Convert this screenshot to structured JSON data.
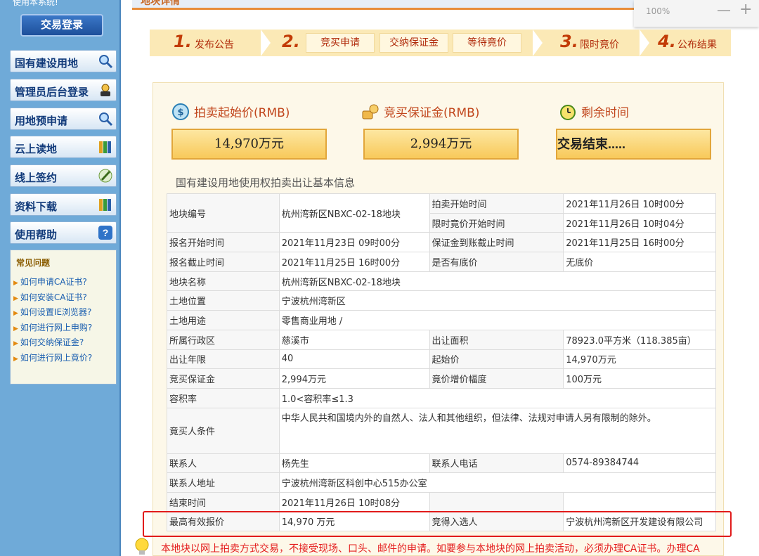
{
  "sidebar": {
    "top_text": "使用本系统!",
    "login_button": "交易登录",
    "nav": [
      {
        "label": "国有建设用地",
        "icon": "magnifier-icon"
      },
      {
        "label": "管理员后台登录",
        "icon": "admin-icon"
      },
      {
        "label": "用地预申请",
        "icon": "magnifier-icon"
      },
      {
        "label": "云上读地",
        "icon": "books-icon"
      },
      {
        "label": "线上签约",
        "icon": "pen-icon"
      },
      {
        "label": "资料下载",
        "icon": "books-icon"
      },
      {
        "label": "使用帮助",
        "icon": "question-icon"
      }
    ],
    "faq": {
      "title": "常见问题",
      "items": [
        "如何申请CA证书?",
        "如何安装CA证书?",
        "如何设置IE浏览器?",
        "如何进行网上申购?",
        "如何交纳保证金?",
        "如何进行网上竟价?"
      ]
    }
  },
  "top": {
    "tab_title": "地块详情",
    "zoom": "100%",
    "zoom_minus": "—",
    "zoom_plus": "+"
  },
  "steps": {
    "s1_num": "1.",
    "s1_text": "发布公告",
    "s2_num": "2.",
    "s2_sub": [
      "竞买申请",
      "交纳保证金",
      "等待竟价"
    ],
    "s3_num": "3.",
    "s3_text": "限时竟价",
    "s4_num": "4.",
    "s4_text": "公布结果"
  },
  "summary": {
    "start_price_label": "拍卖起始价(RMB)",
    "start_price_value": "14,970万元",
    "deposit_label": "竞买保证金(RMB)",
    "deposit_value": "2,994万元",
    "remaining_label": "剩余时间",
    "remaining_value": "交易结束....."
  },
  "section_title": "国有建设用地使用权拍卖出让基本信息",
  "table": {
    "plot_no_label": "地块编号",
    "plot_no": "杭州湾新区NBXC-02-18地块",
    "auction_start_label": "拍卖开始时间",
    "auction_start": "2021年11月26日 10时00分",
    "timed_bid_start_label": "限时竟价开始时间",
    "timed_bid_start": "2021年11月26日 10时04分",
    "reg_start_label": "报名开始时间",
    "reg_start": "2021年11月23日 09时00分",
    "deposit_deadline_label": "保证金到账截止时间",
    "deposit_deadline": "2021年11月25日 16时00分",
    "reg_end_label": "报名截止时间",
    "reg_end": "2021年11月25日 16时00分",
    "reserve_label": "是否有底价",
    "reserve": "无底价",
    "plot_name_label": "地块名称",
    "plot_name": "杭州湾新区NBXC-02-18地块",
    "location_label": "土地位置",
    "location": "宁波杭州湾新区",
    "use_label": "土地用途",
    "use": "零售商业用地 /",
    "district_label": "所属行政区",
    "district": "慈溪市",
    "area_label": "出让面积",
    "area": "78923.0平方米（118.385亩）",
    "term_label": "出让年限",
    "term": "40",
    "start_price_label": "起始价",
    "start_price": "14,970万元",
    "deposit_label": "竞买保证金",
    "deposit": "2,994万元",
    "increment_label": "竟价增价幅度",
    "increment": "100万元",
    "far_label": "容积率",
    "far": "1.0<容积率≤1.3",
    "bidder_cond_label": "竟买人条件",
    "bidder_cond": "中华人民共和国境内外的自然人、法人和其他组织，但法律、法规对申请人另有限制的除外。",
    "contact_label": "联系人",
    "contact": "杨先生",
    "phone_label": "联系人电话",
    "phone": "0574-89384744",
    "address_label": "联系人地址",
    "address": "宁波杭州湾新区科创中心515办公室",
    "end_time_label": "结束时间",
    "end_time": "2021年11月26日 10时08分",
    "highest_bid_label": "最高有效报价",
    "highest_bid": "14,970 万元",
    "winner_label": "竞得入选人",
    "winner": "宁波杭州湾新区开发建设有限公司"
  },
  "notice": "本地块以网上拍卖方式交易，不接受现场、口头、邮件的申请。如要参与本地块的网上拍卖活动，必须办理CA证书。办理CA",
  "colors": {
    "sidebar_bg": "#6faad8",
    "step_accent": "#c23b06",
    "highlight_red": "#e11b1b"
  }
}
